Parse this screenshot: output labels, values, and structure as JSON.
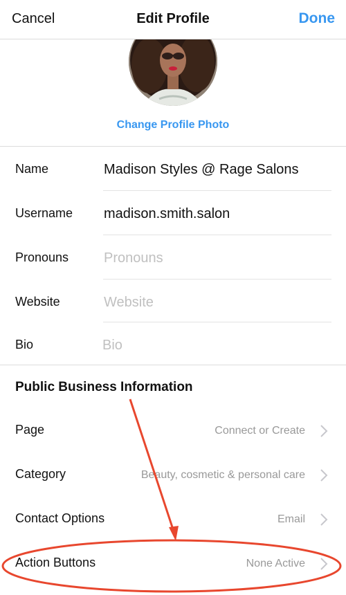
{
  "header": {
    "cancel_label": "Cancel",
    "title": "Edit Profile",
    "done_label": "Done"
  },
  "profile": {
    "change_photo_label": "Change Profile Photo"
  },
  "fields": {
    "name": {
      "label": "Name",
      "value": "Madison Styles @ Rage Salons"
    },
    "username": {
      "label": "Username",
      "value": "madison.smith.salon"
    },
    "pronouns": {
      "label": "Pronouns",
      "placeholder": "Pronouns"
    },
    "website": {
      "label": "Website",
      "placeholder": "Website"
    },
    "bio": {
      "label": "Bio",
      "placeholder": "Bio"
    }
  },
  "business": {
    "section_title": "Public Business Information",
    "rows": [
      {
        "label": "Page",
        "value": "Connect or Create"
      },
      {
        "label": "Category",
        "value": "Beauty, cosmetic & personal care"
      },
      {
        "label": "Contact Options",
        "value": "Email"
      },
      {
        "label": "Action Buttons",
        "value": "None Active"
      }
    ]
  },
  "colors": {
    "accent": "#3897f0",
    "annotation": "#e8472e",
    "secondary_text": "#999999"
  }
}
